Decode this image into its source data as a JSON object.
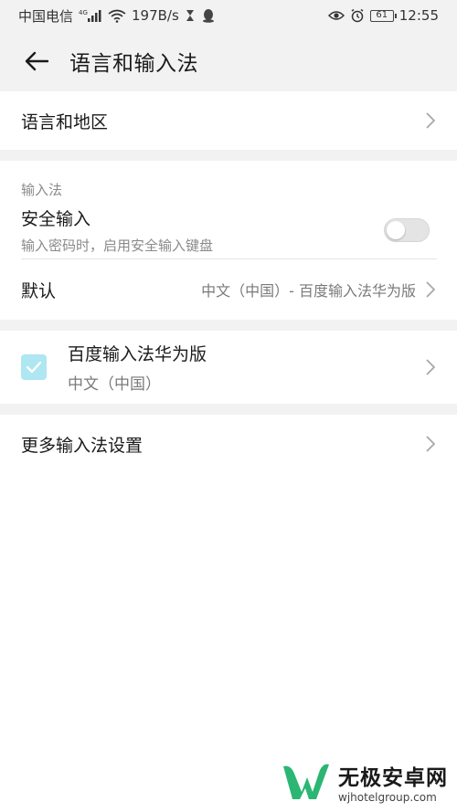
{
  "status_bar": {
    "carrier": "中国电信",
    "network_label": "4G",
    "net_speed": "197B/s",
    "battery_level": "61",
    "time": "12:55"
  },
  "header": {
    "title": "语言和输入法"
  },
  "language_region": {
    "label": "语言和地区"
  },
  "input_method_section": {
    "header": "输入法",
    "secure_input": {
      "label": "安全输入",
      "description": "输入密码时，启用安全输入键盘",
      "enabled": false
    },
    "default": {
      "label": "默认",
      "value": "中文（中国）- 百度输入法华为版"
    }
  },
  "installed_ime": {
    "name": "百度输入法华为版",
    "language": "中文（中国）",
    "checked": true
  },
  "more_settings": {
    "label": "更多输入法设置"
  },
  "watermark": {
    "title": "无极安卓网",
    "url": "wjhotelgroup.com"
  },
  "colors": {
    "background": "#f2f2f2",
    "accent_check": "#aee6f2",
    "watermark_green": "#2bb673"
  }
}
